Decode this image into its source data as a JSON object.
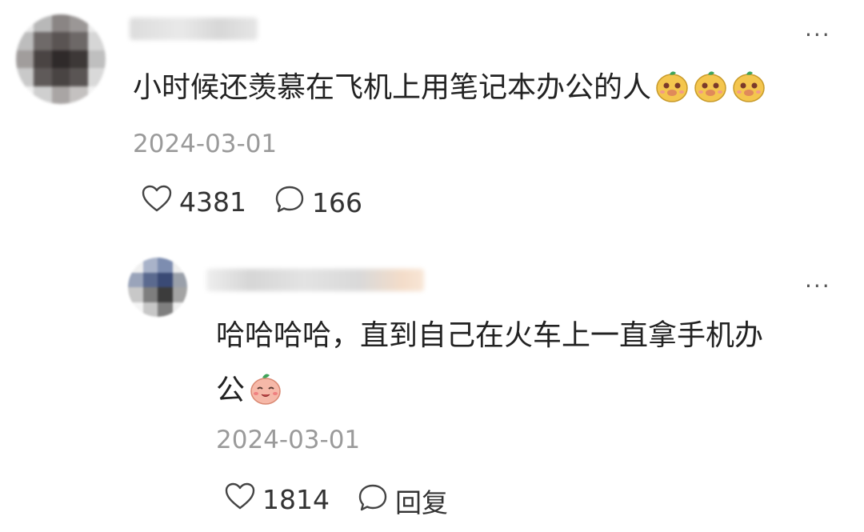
{
  "comment": {
    "text": "小时候还羡慕在飞机上用笔记本办公的人",
    "emoji": [
      "doge-face-icon",
      "doge-face-icon",
      "doge-face-icon"
    ],
    "date": "2024-03-01",
    "likes": "4381",
    "replies": "166",
    "more": "···"
  },
  "reply": {
    "text_line1": "哈哈哈哈，直到自己在火车上一直拿手机办",
    "text_line2": "公",
    "emoji": [
      "smiling-peach-face-icon"
    ],
    "date": "2024-03-01",
    "likes": "1814",
    "reply_label": "回复",
    "more": "···"
  },
  "colors": {
    "text": "#222222",
    "meta": "#9a9a9a",
    "icon": "#444444"
  }
}
